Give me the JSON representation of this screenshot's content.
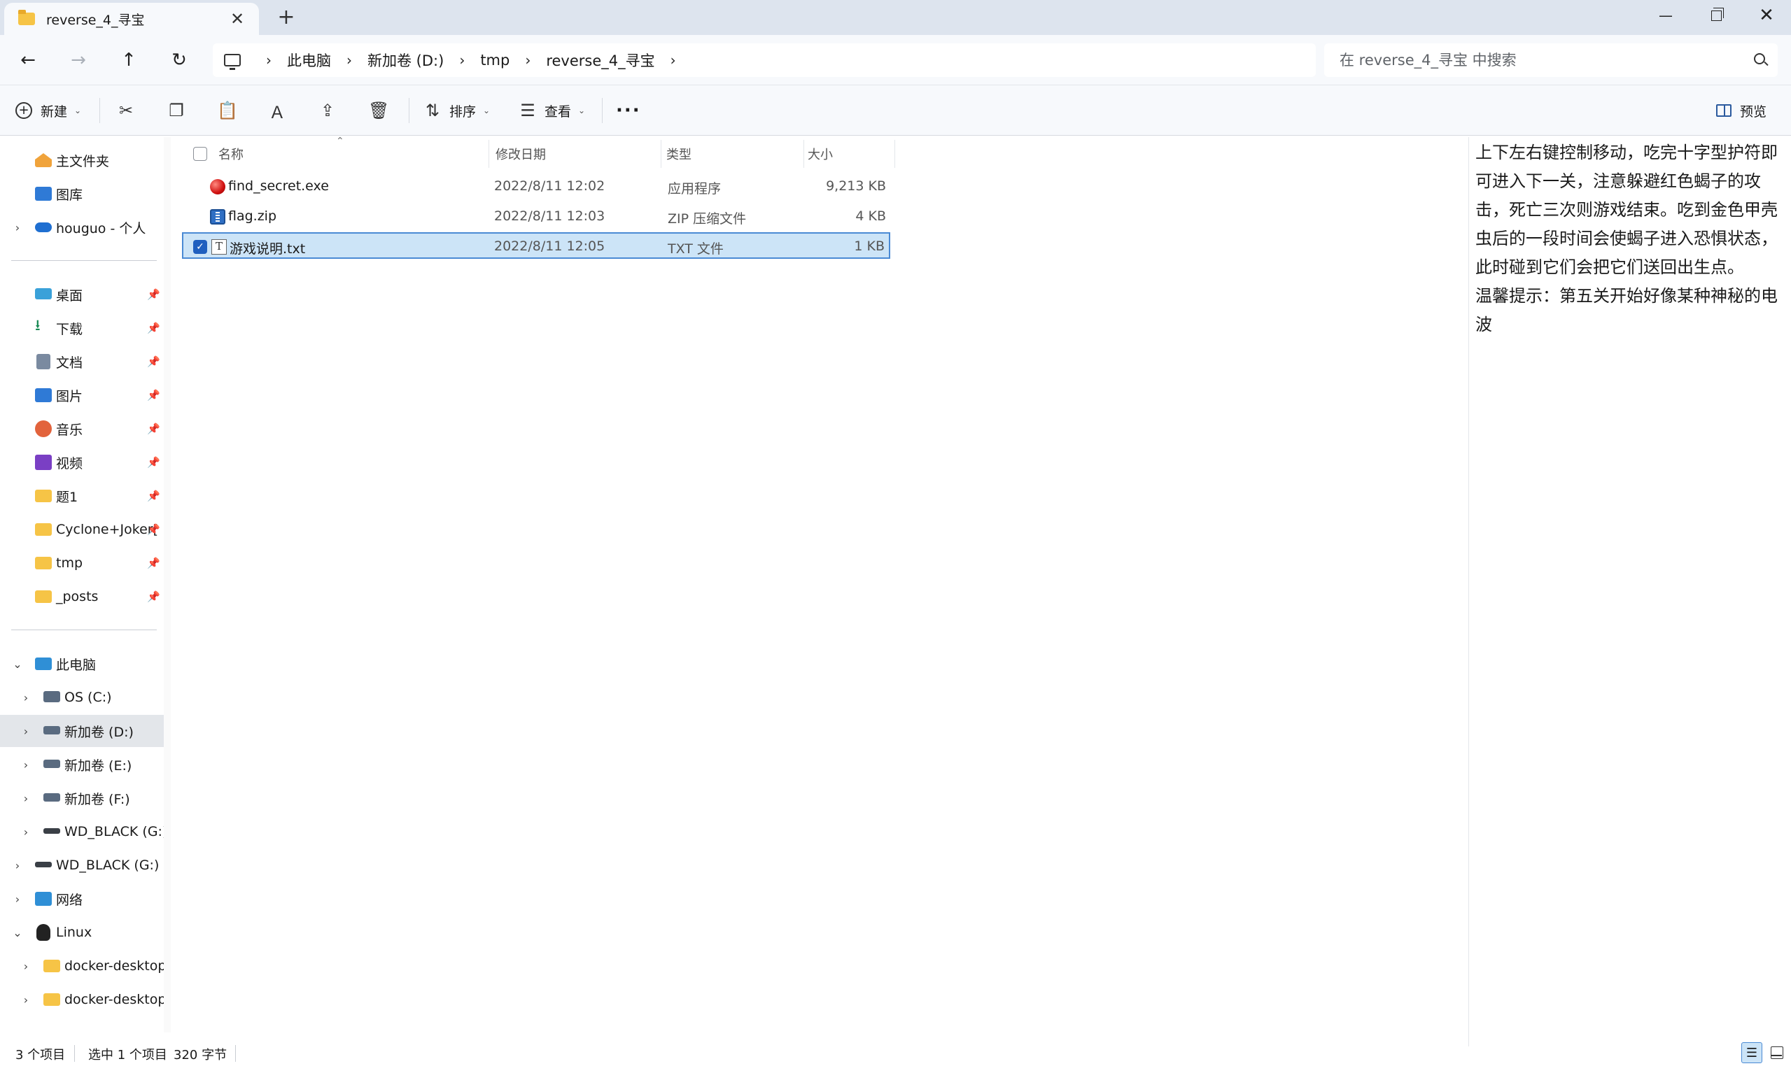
{
  "window": {
    "tab_title": "reverse_4_寻宝",
    "tab_close": "✕",
    "new_tab": "+",
    "minimize": "—",
    "close": "✕"
  },
  "nav": {
    "back": "←",
    "forward": "→",
    "up": "↑",
    "refresh": "↻",
    "breadcrumbs": [
      "此电脑",
      "新加卷 (D:)",
      "tmp",
      "reverse_4_寻宝"
    ],
    "separator": "›",
    "search_placeholder": "在 reverse_4_寻宝 中搜索"
  },
  "commands": {
    "new_label": "新建",
    "sort_label": "排序",
    "view_label": "查看",
    "more": "···",
    "preview_label": "预览",
    "caret": "⌄"
  },
  "sidebar": {
    "top_items": [
      {
        "label": "主文件夹",
        "icon": "home-icon"
      },
      {
        "label": "图库",
        "icon": "gallery-icon"
      },
      {
        "label": "houguo - 个人",
        "icon": "onedrive-icon",
        "chevron": "›"
      }
    ],
    "pinned_items": [
      {
        "label": "桌面",
        "icon": "desktop-icon"
      },
      {
        "label": "下载",
        "icon": "download-icon"
      },
      {
        "label": "文档",
        "icon": "documents-icon"
      },
      {
        "label": "图片",
        "icon": "pictures-icon"
      },
      {
        "label": "音乐",
        "icon": "music-icon"
      },
      {
        "label": "视频",
        "icon": "videos-icon"
      },
      {
        "label": "题1",
        "icon": "folder-icon"
      },
      {
        "label": "Cyclone+Joker[",
        "icon": "folder-icon"
      },
      {
        "label": "tmp",
        "icon": "folder-icon"
      },
      {
        "label": "_posts",
        "icon": "folder-icon"
      }
    ],
    "pin_glyph": "📌",
    "this_pc": {
      "label": "此电脑",
      "chevron": "⌄"
    },
    "drives": [
      {
        "label": "OS (C:)",
        "chevron": "›"
      },
      {
        "label": "新加卷 (D:)",
        "chevron": "›"
      },
      {
        "label": "新加卷 (E:)",
        "chevron": "›"
      },
      {
        "label": "新加卷 (F:)",
        "chevron": "›"
      },
      {
        "label": "WD_BLACK (G:)",
        "chevron": "›"
      }
    ],
    "bottom_items": [
      {
        "label": "WD_BLACK (G:)",
        "chevron": "›"
      },
      {
        "label": "网络",
        "chevron": "›"
      },
      {
        "label": "Linux",
        "chevron": "⌄"
      }
    ],
    "linux_children": [
      {
        "label": "docker-desktop",
        "chevron": "›"
      },
      {
        "label": "docker-desktop-",
        "chevron": "›"
      }
    ]
  },
  "filelist": {
    "columns": {
      "name": "名称",
      "date": "修改日期",
      "type": "类型",
      "size": "大小"
    },
    "sort_arrow": "⌃",
    "rows": [
      {
        "name": "find_secret.exe",
        "date": "2022/8/11 12:02",
        "type": "应用程序",
        "size": "9,213 KB",
        "icon": "exe-icon"
      },
      {
        "name": "flag.zip",
        "date": "2022/8/11 12:03",
        "type": "ZIP 压缩文件",
        "size": "4 KB",
        "icon": "zip-icon"
      },
      {
        "name": "游戏说明.txt",
        "date": "2022/8/11 12:05",
        "type": "TXT 文件",
        "size": "1 KB",
        "icon": "txt-icon",
        "selected": true
      }
    ],
    "check_glyph": "✓",
    "txt_glyph": "T"
  },
  "preview": {
    "lines": [
      "上下左右键控制移动，吃完十字型护符即",
      "可进入下一关，注意躲避红色蝎子的攻",
      "击，死亡三次则游戏结束。吃到金色甲壳",
      "虫后的一段时间会使蝎子进入恐惧状态，",
      "此时碰到它们会把它们送回出生点。",
      "温馨提示：第五关开始好像某种神秘的电",
      "波"
    ]
  },
  "status": {
    "items_count": "3 个项目",
    "selected": "选中 1 个项目",
    "size": "320 字节",
    "details_glyph": "☰"
  },
  "colors": {
    "accent": "#1f5fbf",
    "selection": "#cce4f7",
    "folder": "#f6c446"
  }
}
